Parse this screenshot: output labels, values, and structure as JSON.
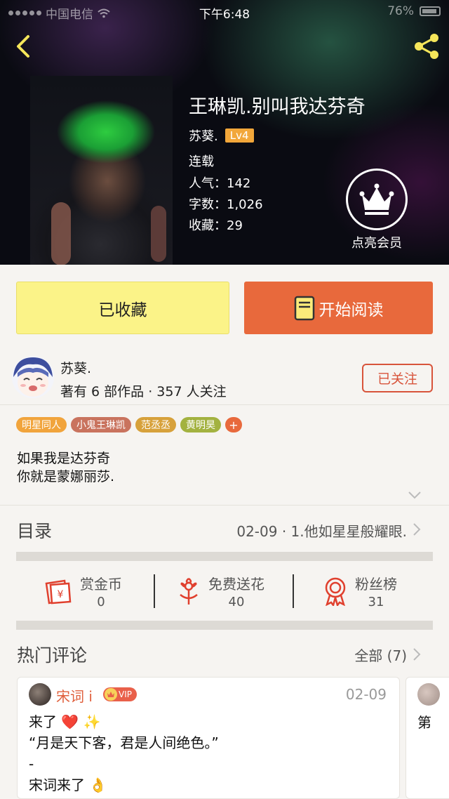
{
  "status_bar": {
    "carrier": "中国电信",
    "time": "下午6:48",
    "battery": "76%"
  },
  "header": {
    "title": "王琳凯.别叫我达芬奇",
    "author": "苏葵.",
    "level": "Lv4",
    "status": "连载",
    "popularity": "人气：142",
    "word_count": "字数：1,026",
    "favorites": "收藏：29",
    "vip_label": "点亮会员"
  },
  "actions": {
    "collected_label": "已收藏",
    "read_label": "开始阅读"
  },
  "author_info": {
    "name": "苏葵.",
    "stats": "著有 6 部作品 · 357 人关注",
    "follow_label": "已关注"
  },
  "tags": [
    {
      "label": "明星同人",
      "color": "#f1a43c"
    },
    {
      "label": "小鬼王琳凯",
      "color": "#c9735e"
    },
    {
      "label": "范丞丞",
      "color": "#d7a13b"
    },
    {
      "label": "黄明昊",
      "color": "#a3b240"
    }
  ],
  "tag_more": "+",
  "intro": {
    "line1": "如果我是达芬奇",
    "line2": "你就是蒙娜丽莎."
  },
  "catalog": {
    "title": "目录",
    "latest": "02-09 · 1.他如星星般耀眼."
  },
  "stats": [
    {
      "label": "赏金币",
      "value": "0",
      "icon": "red-envelope-yen-icon"
    },
    {
      "label": "免费送花",
      "value": "40",
      "icon": "flower-icon"
    },
    {
      "label": "粉丝榜",
      "value": "31",
      "icon": "medal-icon"
    }
  ],
  "comments": {
    "title": "热门评论",
    "all_label": "全部 (7)",
    "items": [
      {
        "user": "宋词 i",
        "badge": "VIP",
        "date": "02-09",
        "body": "来了 ❤️ ✨\n“月是天下客，君是人间绝色。”\n-\n宋词来了 👌"
      },
      {
        "preview": "第"
      }
    ]
  },
  "colors": {
    "accent_orange": "#e8693c",
    "collected_yellow": "#fbf388",
    "link_red": "#d8543b"
  }
}
